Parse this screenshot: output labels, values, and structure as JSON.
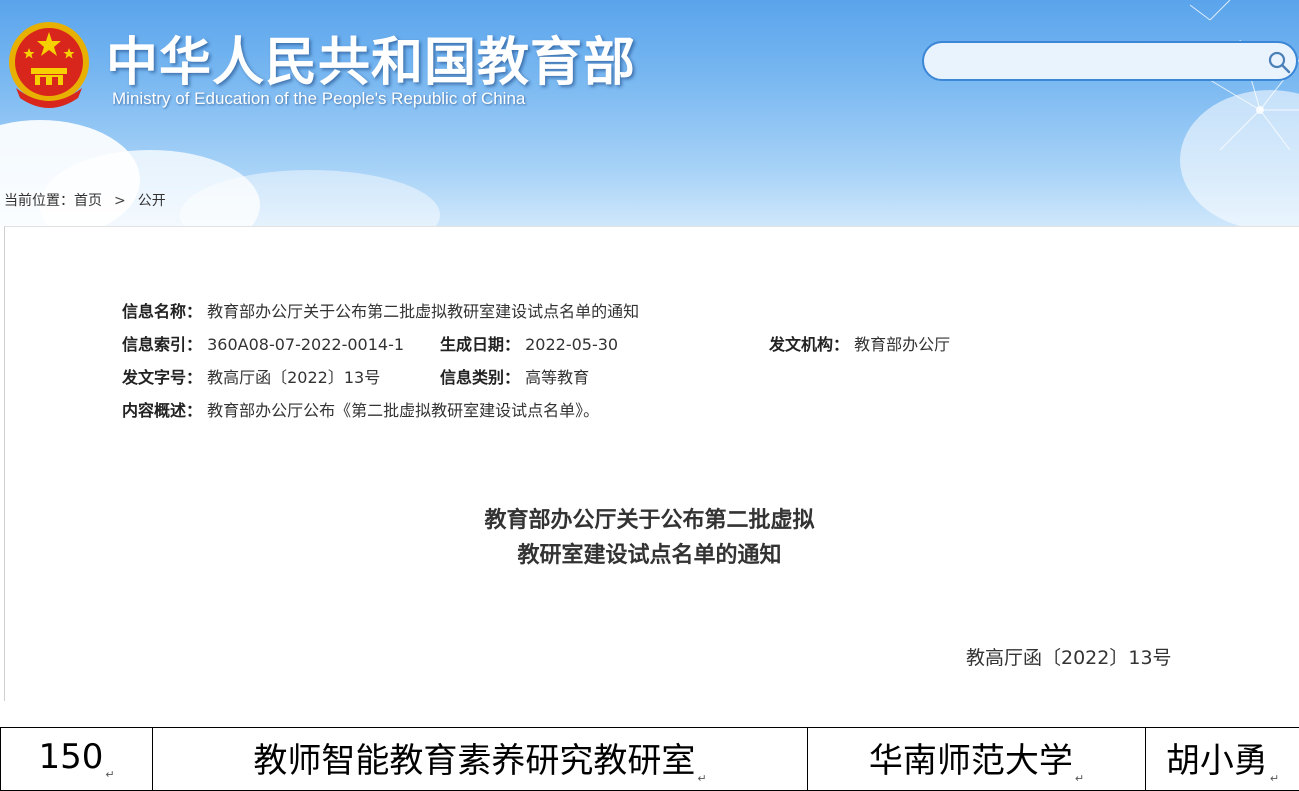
{
  "header": {
    "title": "中华人民共和国教育部",
    "subtitle": "Ministry of Education of the People's Republic of China",
    "search": {
      "placeholder": ""
    },
    "colors": {
      "sky": "#6aaeee",
      "accent": "#3c86d6"
    }
  },
  "breadcrumb": {
    "prefix": "当前位置：",
    "items": [
      "首页",
      "公开"
    ],
    "separator": ">"
  },
  "meta": {
    "name_label": "信息名称：",
    "name_value": "教育部办公厅关于公布第二批虚拟教研室建设试点名单的通知",
    "index_label": "信息索引：",
    "index_value": "360A08-07-2022-0014-1",
    "date_label": "生成日期：",
    "date_value": "2022-05-30",
    "org_label": "发文机构：",
    "org_value": "教育部办公厅",
    "docno_label": "发文字号：",
    "docno_value": "教高厅函〔2022〕13号",
    "category_label": "信息类别：",
    "category_value": "高等教育",
    "summary_label": "内容概述：",
    "summary_value": "教育部办公厅公布《第二批虚拟教研室建设试点名单》。"
  },
  "document": {
    "title_line1": "教育部办公厅关于公布第二批虚拟",
    "title_line2": "教研室建设试点名单的通知",
    "number": "教高厅函〔2022〕13号"
  },
  "table": {
    "row": [
      "150",
      "教师智能教育素养研究教研室",
      "华南师范大学",
      "胡小勇"
    ],
    "mark": "↵"
  }
}
